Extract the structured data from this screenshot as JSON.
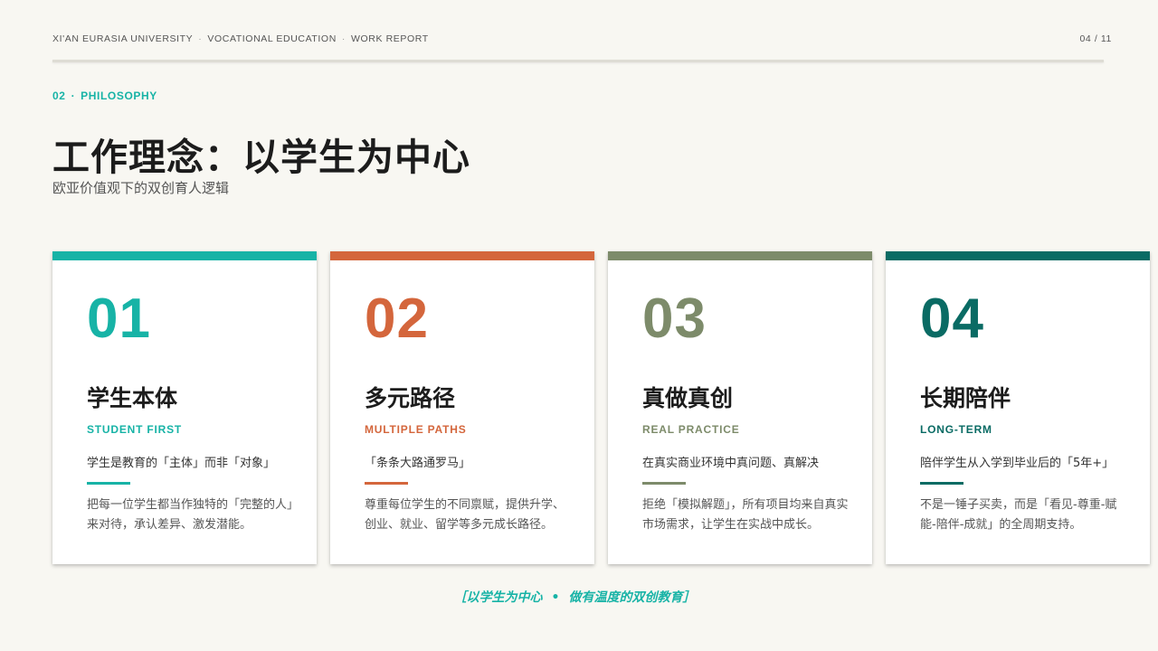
{
  "header": {
    "left_parts": [
      "XI'AN EURASIA UNIVERSITY",
      "VOCATIONAL EDUCATION",
      "WORK REPORT"
    ],
    "separator": "·",
    "page_number": "04 / 11"
  },
  "section": {
    "number": "02",
    "separator": "·",
    "label": "PHILOSOPHY"
  },
  "title": "工作理念：以学生为中心",
  "subtitle": "欧亚价值观下的双创育人逻辑",
  "cards": [
    {
      "number": "01",
      "title": "学生本体",
      "english": "STUDENT FIRST",
      "lead": "学生是教育的「主体」而非「对象」",
      "description": "把每一位学生都当作独特的「完整的人」来对待，承认差异、激发潜能。",
      "color": "#17b3a6"
    },
    {
      "number": "02",
      "title": "多元路径",
      "english": "MULTIPLE PATHS",
      "lead": "「条条大路通罗马」",
      "description": "尊重每位学生的不同禀赋，提供升学、创业、就业、留学等多元成长路径。",
      "color": "#d4663c"
    },
    {
      "number": "03",
      "title": "真做真创",
      "english": "REAL PRACTICE",
      "lead": "在真实商业环境中真问题、真解决",
      "description": "拒绝「模拟解题」，所有项目均来自真实市场需求，让学生在实战中成长。",
      "color": "#7d8b6a"
    },
    {
      "number": "04",
      "title": "长期陪伴",
      "english": "LONG-TERM",
      "lead": "陪伴学生从入学到毕业后的「5年+」",
      "description": "不是一锤子买卖，而是「看见-尊重-赋能-陪伴-成就」的全周期支持。",
      "color": "#0a6b64"
    }
  ],
  "footer": {
    "left": "［以学生为中心",
    "bullet": "•",
    "right": "做有温度的双创教育］"
  }
}
